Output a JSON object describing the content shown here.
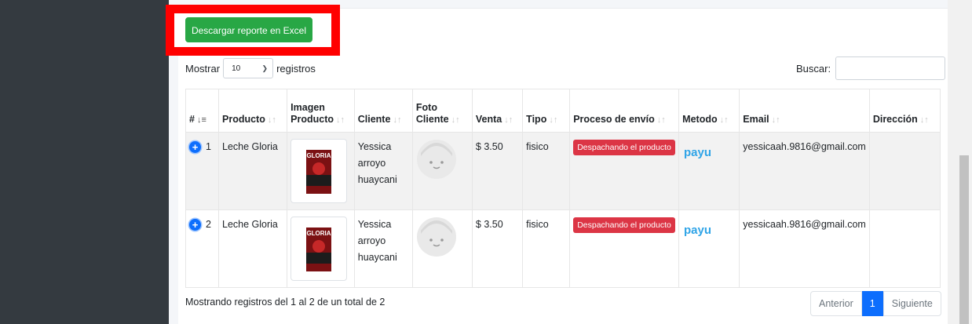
{
  "export_button_label": "Descargar reporte en Excel",
  "length_control": {
    "prefix": "Mostrar",
    "value": "10",
    "suffix": "registros"
  },
  "search": {
    "label": "Buscar:",
    "value": ""
  },
  "table": {
    "columns": [
      "#",
      "Producto",
      "Imagen Producto",
      "Cliente",
      "Foto Cliente",
      "Venta",
      "Tipo",
      "Proceso de envío",
      "Metodo",
      "Email",
      "Dirección"
    ],
    "rows": [
      {
        "num": "1",
        "product": "Leche Gloria",
        "image_text": "GLORIA",
        "client": "Yessica arroyo huaycani",
        "sale": "$ 3.50",
        "type": "fisico",
        "shipping": "Despachando el producto",
        "method": "payu",
        "email": "yessicaah.9816@gmail.com",
        "address": ""
      },
      {
        "num": "2",
        "product": "Leche Gloria",
        "image_text": "GLORIA",
        "client": "Yessica arroyo huaycani",
        "sale": "$ 3.50",
        "type": "fisico",
        "shipping": "Despachando el producto",
        "method": "payu",
        "email": "yessicaah.9816@gmail.com",
        "address": ""
      }
    ]
  },
  "footer": {
    "info": "Mostrando registros del 1 al 2 de un total de 2",
    "prev": "Anterior",
    "page": "1",
    "next": "Siguiente"
  },
  "colors": {
    "export": "#28a745",
    "highlight": "#ff0000",
    "badge": "#dc3545",
    "pager_active": "#0d6efd",
    "sidebar": "#343a40"
  }
}
